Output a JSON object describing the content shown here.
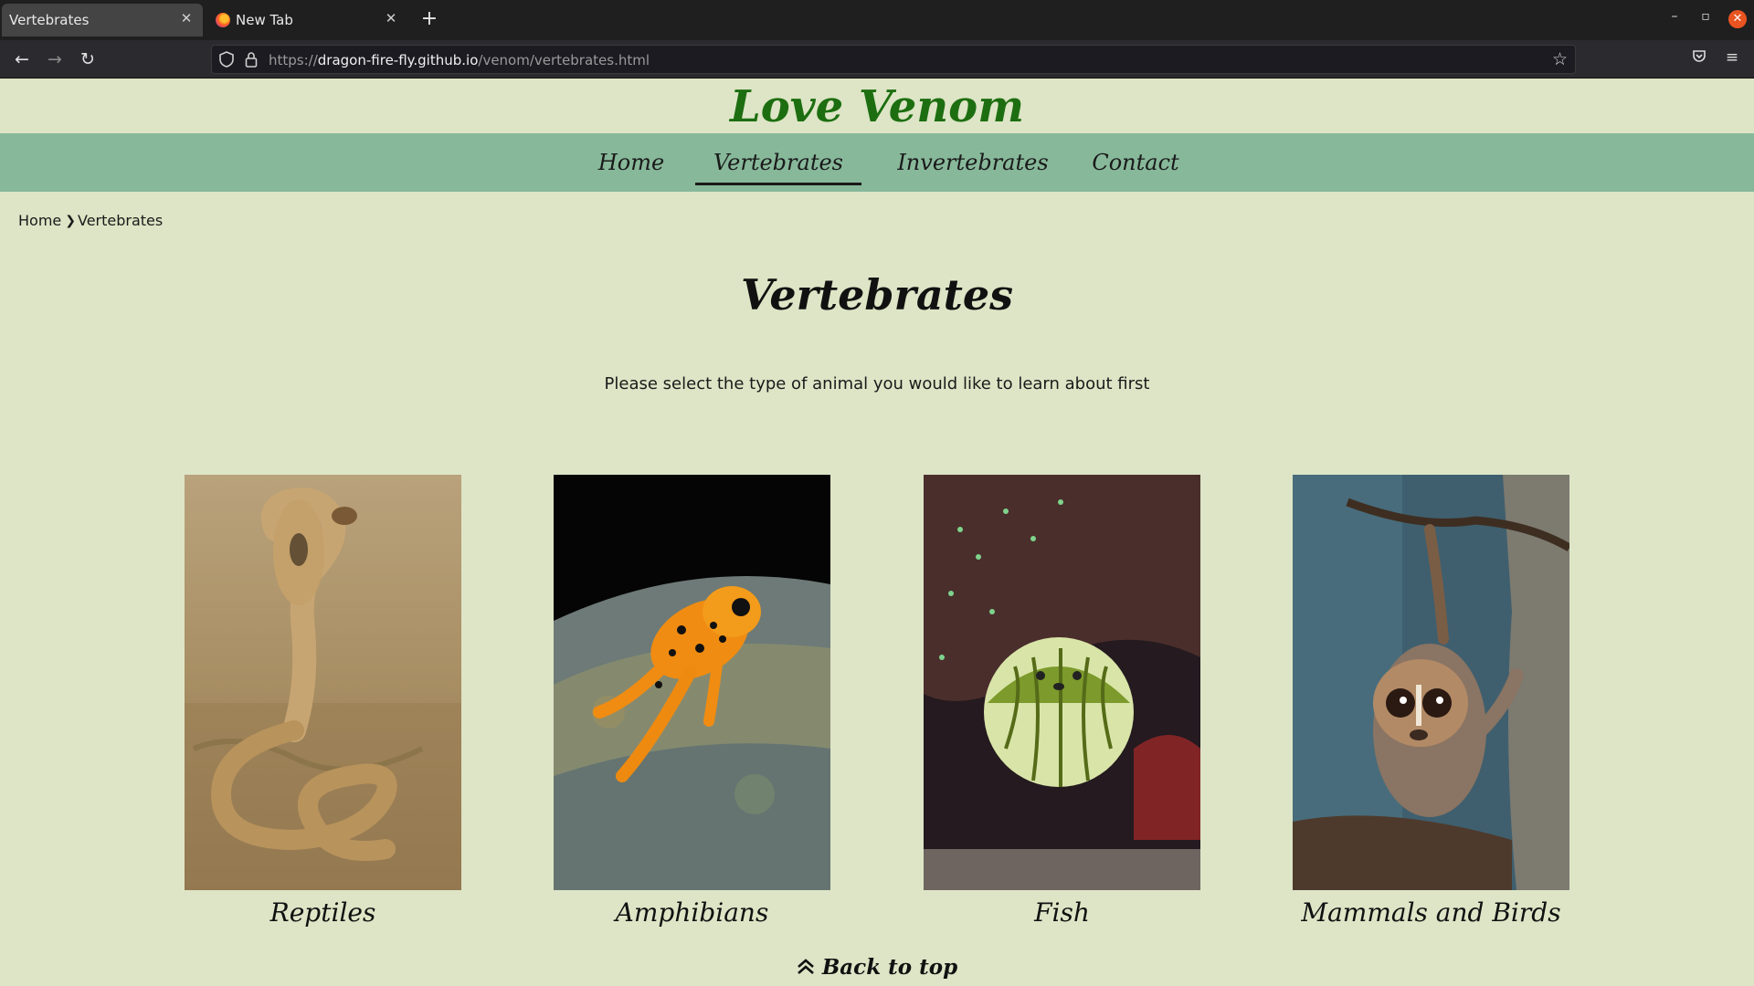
{
  "browser": {
    "tabs": [
      {
        "title": "Vertebrates",
        "active": true
      },
      {
        "title": "New Tab",
        "active": false
      }
    ],
    "url_prefix": "https://",
    "url_host": "dragon-fire-fly.github.io",
    "url_path": "/venom/vertebrates.html",
    "icons": {
      "back": "back-arrow-icon",
      "forward": "forward-arrow-icon",
      "reload": "reload-icon",
      "shield": "tracking-shield-icon",
      "lock": "lock-icon",
      "bookmark": "star-icon",
      "pocket": "pocket-icon",
      "menu": "hamburger-menu-icon"
    }
  },
  "site": {
    "title": "Love Venom",
    "nav": [
      {
        "label": "Home",
        "active": false
      },
      {
        "label": "Vertebrates",
        "active": true
      },
      {
        "label": "Invertebrates",
        "active": false
      },
      {
        "label": "Contact",
        "active": false
      }
    ],
    "nav_color": "#87b89a",
    "title_color": "#1d6e10",
    "bg_color": "#dde5c6"
  },
  "breadcrumb": {
    "home": "Home",
    "current": "Vertebrates"
  },
  "page": {
    "heading": "Vertebrates",
    "intro": "Please select the type of animal you would like to learn about first",
    "back_to_top": "Back to top"
  },
  "categories": [
    {
      "label": "Reptiles",
      "image": "cobra"
    },
    {
      "label": "Amphibians",
      "image": "poison-dart-frog"
    },
    {
      "label": "Fish",
      "image": "pufferfish"
    },
    {
      "label": "Mammals and Birds",
      "image": "slow-loris"
    }
  ]
}
